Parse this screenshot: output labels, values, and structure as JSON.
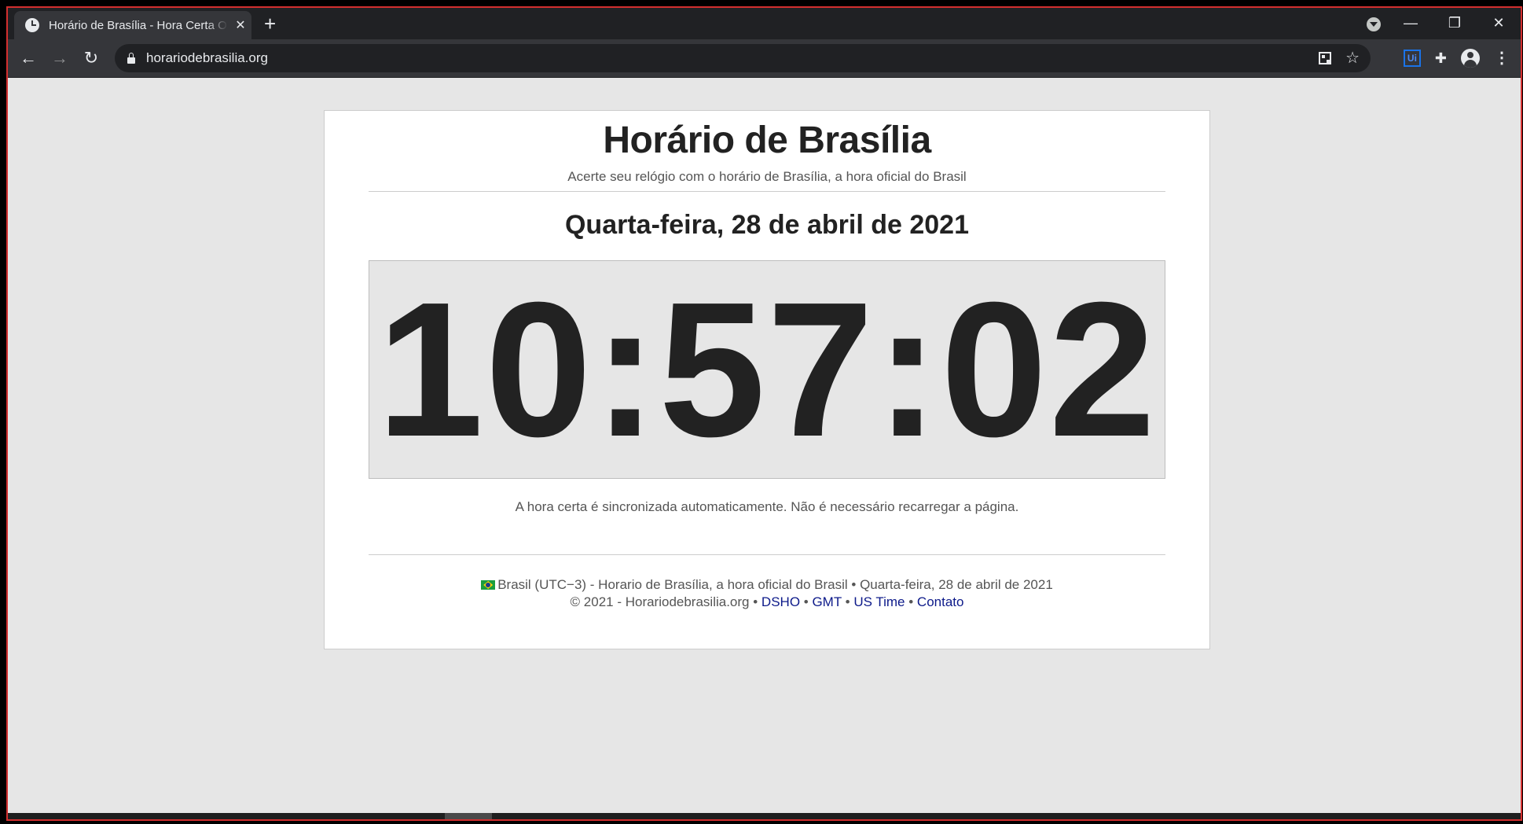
{
  "browser": {
    "tab_title": "Horário de Brasília - Hora Certa O",
    "tab_close": "✕",
    "new_tab": "+",
    "url": "horariodebrasilia.org",
    "window_controls": {
      "minimize": "—",
      "maximize": "❐",
      "close": "✕"
    },
    "nav": {
      "back": "←",
      "forward": "→",
      "reload": "↻"
    },
    "icons": {
      "star": "☆",
      "puzzle": "✚",
      "menu": "⋮",
      "ext_label": "Ui"
    }
  },
  "page": {
    "title": "Horário de Brasília",
    "subtitle": "Acerte seu relógio com o horário de Brasília, a hora oficial do Brasil",
    "date": "Quarta-feira, 28 de abril de 2021",
    "time": "10:57:02",
    "sync_note": "A hora certa é sincronizada automaticamente. Não é necessário recarregar a página.",
    "footer": {
      "line1": "Brasil (UTC−3) - Horario de Brasília, a hora oficial do Brasil • Quarta-feira, 28 de abril de 2021",
      "copyright": "© 2021 - Horariodebrasilia.org",
      "separator": " • ",
      "links": [
        "DSHO",
        "GMT",
        "US Time",
        "Contato"
      ]
    }
  },
  "colors": {
    "link": "#0d1a8a",
    "chrome_dark": "#202124",
    "chrome_tab": "#35363a",
    "page_bg": "#e6e6e6"
  }
}
